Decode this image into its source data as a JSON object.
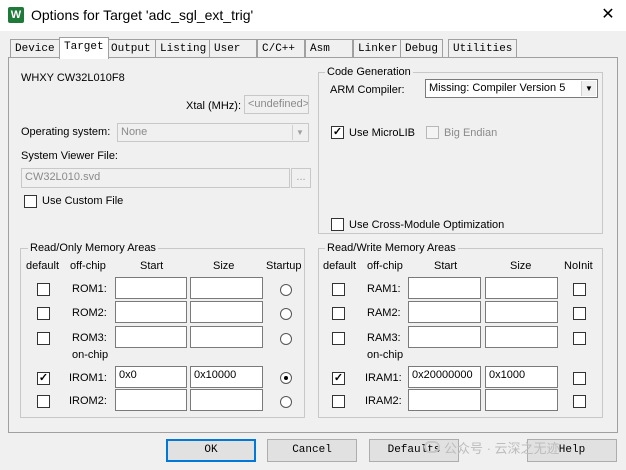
{
  "window": {
    "title": "Options for Target 'adc_sgl_ext_trig'",
    "close_glyph": "✕",
    "icon_letter": "W"
  },
  "tabs": [
    {
      "label": "Device"
    },
    {
      "label": "Target"
    },
    {
      "label": "Output"
    },
    {
      "label": "Listing"
    },
    {
      "label": "User"
    },
    {
      "label": "C/C++"
    },
    {
      "label": "Asm"
    },
    {
      "label": "Linker"
    },
    {
      "label": "Debug"
    },
    {
      "label": "Utilities"
    }
  ],
  "active_tab": "Target",
  "device": {
    "name": "WHXY CW32L010F8",
    "xtal_label": "Xtal (MHz):",
    "xtal_value": "<undefined>",
    "os_label": "Operating system:",
    "os_value": "None",
    "svd_label": "System Viewer File:",
    "svd_value": "CW32L010.svd",
    "browse_label": "...",
    "use_custom_file_label": "Use Custom File",
    "use_custom_file_checked": false
  },
  "code_generation": {
    "title": "Code Generation",
    "arm_compiler_label": "ARM Compiler:",
    "arm_compiler_value": "Missing: Compiler Version 5",
    "use_microlib_label": "Use MicroLIB",
    "use_microlib_checked": true,
    "big_endian_label": "Big Endian",
    "big_endian_checked": false,
    "cross_module_label": "Use Cross-Module Optimization",
    "cross_module_checked": false
  },
  "rom_areas": {
    "title": "Read/Only Memory Areas",
    "headers": {
      "default": "default",
      "offchip": "off-chip",
      "start": "Start",
      "size": "Size",
      "startup": "Startup"
    },
    "onchip_label": "on-chip",
    "rows": [
      {
        "label": "ROM1:",
        "default": false,
        "start": "",
        "size": "",
        "startup": false
      },
      {
        "label": "ROM2:",
        "default": false,
        "start": "",
        "size": "",
        "startup": false
      },
      {
        "label": "ROM3:",
        "default": false,
        "start": "",
        "size": "",
        "startup": false
      },
      {
        "label": "IROM1:",
        "default": true,
        "start": "0x0",
        "size": "0x10000",
        "startup": true
      },
      {
        "label": "IROM2:",
        "default": false,
        "start": "",
        "size": "",
        "startup": false
      }
    ]
  },
  "ram_areas": {
    "title": "Read/Write Memory Areas",
    "headers": {
      "default": "default",
      "offchip": "off-chip",
      "start": "Start",
      "size": "Size",
      "noinit": "NoInit"
    },
    "onchip_label": "on-chip",
    "rows": [
      {
        "label": "RAM1:",
        "default": false,
        "start": "",
        "size": "",
        "noinit": false
      },
      {
        "label": "RAM2:",
        "default": false,
        "start": "",
        "size": "",
        "noinit": false
      },
      {
        "label": "RAM3:",
        "default": false,
        "start": "",
        "size": "",
        "noinit": false
      },
      {
        "label": "IRAM1:",
        "default": true,
        "start": "0x20000000",
        "size": "0x1000",
        "noinit": false
      },
      {
        "label": "IRAM2:",
        "default": false,
        "start": "",
        "size": "",
        "noinit": false
      }
    ]
  },
  "buttons": {
    "ok": "OK",
    "cancel": "Cancel",
    "defaults": "Defaults",
    "help": "Help"
  },
  "watermark": "公众号 · 云深之无迹",
  "check_glyph": "✓"
}
